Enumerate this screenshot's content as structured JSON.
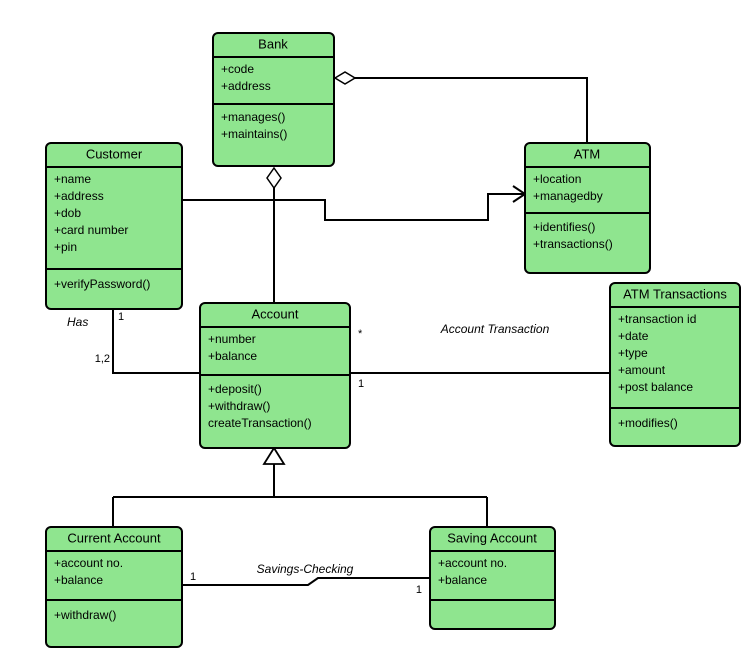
{
  "classes": {
    "bank": {
      "name": "Bank",
      "attrs": [
        "+code",
        "+address"
      ],
      "ops": [
        "+manages()",
        "+maintains()"
      ]
    },
    "customer": {
      "name": "Customer",
      "attrs": [
        "+name",
        "+address",
        "+dob",
        "+card number",
        "+pin"
      ],
      "ops": [
        "+verifyPassword()"
      ]
    },
    "atm": {
      "name": "ATM",
      "attrs": [
        "+location",
        "+managedby"
      ],
      "ops": [
        "+identifies()",
        "+transactions()"
      ]
    },
    "account": {
      "name": "Account",
      "attrs": [
        "+number",
        "+balance"
      ],
      "ops": [
        "+deposit()",
        "+withdraw()",
        "createTransaction()"
      ]
    },
    "atm_tx": {
      "name": "ATM Transactions",
      "attrs": [
        "+transaction id",
        "+date",
        "+type",
        "+amount",
        "+post balance"
      ],
      "ops": [
        "+modifies()"
      ]
    },
    "current": {
      "name": "Current Account",
      "attrs": [
        "+account no.",
        "+balance"
      ],
      "ops": [
        "+withdraw()"
      ]
    },
    "saving": {
      "name": "Saving Account",
      "attrs": [
        "+account no.",
        "+balance"
      ],
      "ops": []
    }
  },
  "labels": {
    "has": "Has",
    "acct_tx": "Account Transaction",
    "savings_checking": "Savings-Checking"
  },
  "mult": {
    "has_customer": "1",
    "has_account": "1,2",
    "account_tx_star": "*",
    "account_tx_one": "1",
    "current_one": "1",
    "saving_one": "1"
  },
  "colors": {
    "fill": "#8FE58F",
    "stroke": "#000000"
  },
  "chart_data": {
    "type": "uml_class_diagram",
    "classes": [
      {
        "id": "Bank",
        "attributes": [
          "code",
          "address"
        ],
        "operations": [
          "manages()",
          "maintains()"
        ]
      },
      {
        "id": "Customer",
        "attributes": [
          "name",
          "address",
          "dob",
          "card number",
          "pin"
        ],
        "operations": [
          "verifyPassword()"
        ]
      },
      {
        "id": "ATM",
        "attributes": [
          "location",
          "managedby"
        ],
        "operations": [
          "identifies()",
          "transactions()"
        ]
      },
      {
        "id": "Account",
        "attributes": [
          "number",
          "balance"
        ],
        "operations": [
          "deposit()",
          "withdraw()",
          "createTransaction()"
        ]
      },
      {
        "id": "ATM Transactions",
        "attributes": [
          "transaction id",
          "date",
          "type",
          "amount",
          "post balance"
        ],
        "operations": [
          "modifies()"
        ]
      },
      {
        "id": "Current Account",
        "attributes": [
          "account no.",
          "balance"
        ],
        "operations": [
          "withdraw()"
        ]
      },
      {
        "id": "Saving Account",
        "attributes": [
          "account no.",
          "balance"
        ],
        "operations": []
      }
    ],
    "relations": [
      {
        "from": "Bank",
        "to": "ATM",
        "type": "aggregation",
        "diamond_at": "Bank"
      },
      {
        "from": "Bank",
        "to": "Account",
        "type": "aggregation",
        "diamond_at": "Bank"
      },
      {
        "from": "Customer",
        "to": "Account",
        "type": "association",
        "name": "Has",
        "multiplicity": {
          "Customer": "1",
          "Account": "1,2"
        }
      },
      {
        "from": "Customer",
        "to": "ATM",
        "type": "association",
        "arrow_to": "ATM"
      },
      {
        "from": "Account",
        "to": "ATM Transactions",
        "type": "association",
        "name": "Account Transaction",
        "multiplicity": {
          "Account": "*",
          "ATM Transactions": "1"
        }
      },
      {
        "from": "Current Account",
        "to": "Account",
        "type": "generalization",
        "parent": "Account"
      },
      {
        "from": "Saving Account",
        "to": "Account",
        "type": "generalization",
        "parent": "Account"
      },
      {
        "from": "Current Account",
        "to": "Saving Account",
        "type": "association",
        "name": "Savings-Checking",
        "multiplicity": {
          "Current Account": "1",
          "Saving Account": "1"
        }
      }
    ]
  }
}
